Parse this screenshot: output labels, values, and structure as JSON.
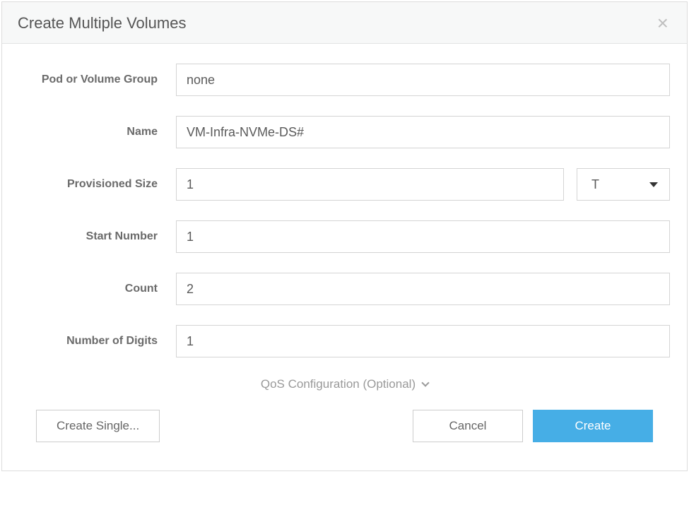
{
  "dialog": {
    "title": "Create Multiple Volumes"
  },
  "labels": {
    "pod": "Pod or Volume Group",
    "name": "Name",
    "size": "Provisioned Size",
    "start": "Start Number",
    "count": "Count",
    "digits": "Number of Digits",
    "qos": "QoS Configuration (Optional)"
  },
  "values": {
    "pod": "none",
    "name": "VM-Infra-NVMe-DS#",
    "size": "1",
    "unit": "T",
    "start": "1",
    "count": "2",
    "digits": "1"
  },
  "buttons": {
    "single": "Create Single...",
    "cancel": "Cancel",
    "create": "Create"
  }
}
